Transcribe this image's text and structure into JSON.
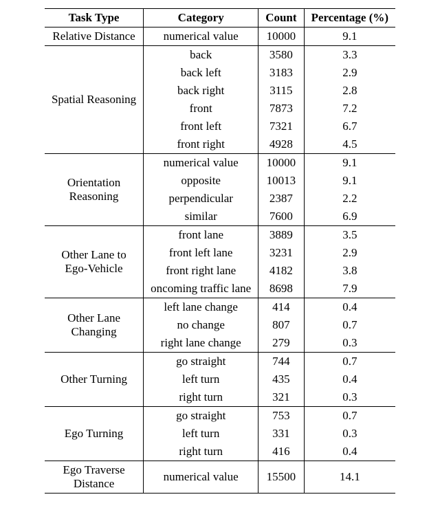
{
  "headers": {
    "task_type": "Task Type",
    "category": "Category",
    "count": "Count",
    "percentage": "Percentage (%)"
  },
  "groups": [
    {
      "task_type": "Relative Distance",
      "rows": [
        {
          "category": "numerical value",
          "count": "10000",
          "percentage": "9.1"
        }
      ]
    },
    {
      "task_type": "Spatial Reasoning",
      "rows": [
        {
          "category": "back",
          "count": "3580",
          "percentage": "3.3"
        },
        {
          "category": "back left",
          "count": "3183",
          "percentage": "2.9"
        },
        {
          "category": "back right",
          "count": "3115",
          "percentage": "2.8"
        },
        {
          "category": "front",
          "count": "7873",
          "percentage": "7.2"
        },
        {
          "category": "front left",
          "count": "7321",
          "percentage": "6.7"
        },
        {
          "category": "front right",
          "count": "4928",
          "percentage": "4.5"
        }
      ]
    },
    {
      "task_type": "Orientation Reasoning",
      "task_type_lines": [
        "Orientation",
        "Reasoning"
      ],
      "rows": [
        {
          "category": "numerical value",
          "count": "10000",
          "percentage": "9.1"
        },
        {
          "category": "opposite",
          "count": "10013",
          "percentage": "9.1"
        },
        {
          "category": "perpendicular",
          "count": "2387",
          "percentage": "2.2"
        },
        {
          "category": "similar",
          "count": "7600",
          "percentage": "6.9"
        }
      ]
    },
    {
      "task_type": "Other Lane to Ego-Vehicle",
      "task_type_lines": [
        "Other Lane to",
        "Ego-Vehicle"
      ],
      "rows": [
        {
          "category": "front lane",
          "count": "3889",
          "percentage": "3.5"
        },
        {
          "category": "front left lane",
          "count": "3231",
          "percentage": "2.9"
        },
        {
          "category": "front right lane",
          "count": "4182",
          "percentage": "3.8"
        },
        {
          "category": "oncoming traffic lane",
          "count": "8698",
          "percentage": "7.9"
        }
      ]
    },
    {
      "task_type": "Other Lane Changing",
      "task_type_lines": [
        "Other Lane",
        "Changing"
      ],
      "rows": [
        {
          "category": "left lane change",
          "count": "414",
          "percentage": "0.4"
        },
        {
          "category": "no change",
          "count": "807",
          "percentage": "0.7"
        },
        {
          "category": "right lane change",
          "count": "279",
          "percentage": "0.3"
        }
      ]
    },
    {
      "task_type": "Other Turning",
      "rows": [
        {
          "category": "go straight",
          "count": "744",
          "percentage": "0.7"
        },
        {
          "category": "left turn",
          "count": "435",
          "percentage": "0.4"
        },
        {
          "category": "right turn",
          "count": "321",
          "percentage": "0.3"
        }
      ]
    },
    {
      "task_type": "Ego Turning",
      "rows": [
        {
          "category": "go straight",
          "count": "753",
          "percentage": "0.7"
        },
        {
          "category": "left turn",
          "count": "331",
          "percentage": "0.3"
        },
        {
          "category": "right turn",
          "count": "416",
          "percentage": "0.4"
        }
      ]
    },
    {
      "task_type": "Ego Traverse Distance",
      "task_type_lines": [
        "Ego Traverse",
        "Distance"
      ],
      "rows": [
        {
          "category": "numerical value",
          "count": "15500",
          "percentage": "14.1"
        }
      ]
    }
  ],
  "chart_data": {
    "type": "table",
    "columns": [
      "Task Type",
      "Category",
      "Count",
      "Percentage (%)"
    ],
    "rows": [
      [
        "Relative Distance",
        "numerical value",
        10000,
        9.1
      ],
      [
        "Spatial Reasoning",
        "back",
        3580,
        3.3
      ],
      [
        "Spatial Reasoning",
        "back left",
        3183,
        2.9
      ],
      [
        "Spatial Reasoning",
        "back right",
        3115,
        2.8
      ],
      [
        "Spatial Reasoning",
        "front",
        7873,
        7.2
      ],
      [
        "Spatial Reasoning",
        "front left",
        7321,
        6.7
      ],
      [
        "Spatial Reasoning",
        "front right",
        4928,
        4.5
      ],
      [
        "Orientation Reasoning",
        "numerical value",
        10000,
        9.1
      ],
      [
        "Orientation Reasoning",
        "opposite",
        10013,
        9.1
      ],
      [
        "Orientation Reasoning",
        "perpendicular",
        2387,
        2.2
      ],
      [
        "Orientation Reasoning",
        "similar",
        7600,
        6.9
      ],
      [
        "Other Lane to Ego-Vehicle",
        "front lane",
        3889,
        3.5
      ],
      [
        "Other Lane to Ego-Vehicle",
        "front left lane",
        3231,
        2.9
      ],
      [
        "Other Lane to Ego-Vehicle",
        "front right lane",
        4182,
        3.8
      ],
      [
        "Other Lane to Ego-Vehicle",
        "oncoming traffic lane",
        8698,
        7.9
      ],
      [
        "Other Lane Changing",
        "left lane change",
        414,
        0.4
      ],
      [
        "Other Lane Changing",
        "no change",
        807,
        0.7
      ],
      [
        "Other Lane Changing",
        "right lane change",
        279,
        0.3
      ],
      [
        "Other Turning",
        "go straight",
        744,
        0.7
      ],
      [
        "Other Turning",
        "left turn",
        435,
        0.4
      ],
      [
        "Other Turning",
        "right turn",
        321,
        0.3
      ],
      [
        "Ego Turning",
        "go straight",
        753,
        0.7
      ],
      [
        "Ego Turning",
        "left turn",
        331,
        0.3
      ],
      [
        "Ego Turning",
        "right turn",
        416,
        0.4
      ],
      [
        "Ego Traverse Distance",
        "numerical value",
        15500,
        14.1
      ]
    ]
  }
}
